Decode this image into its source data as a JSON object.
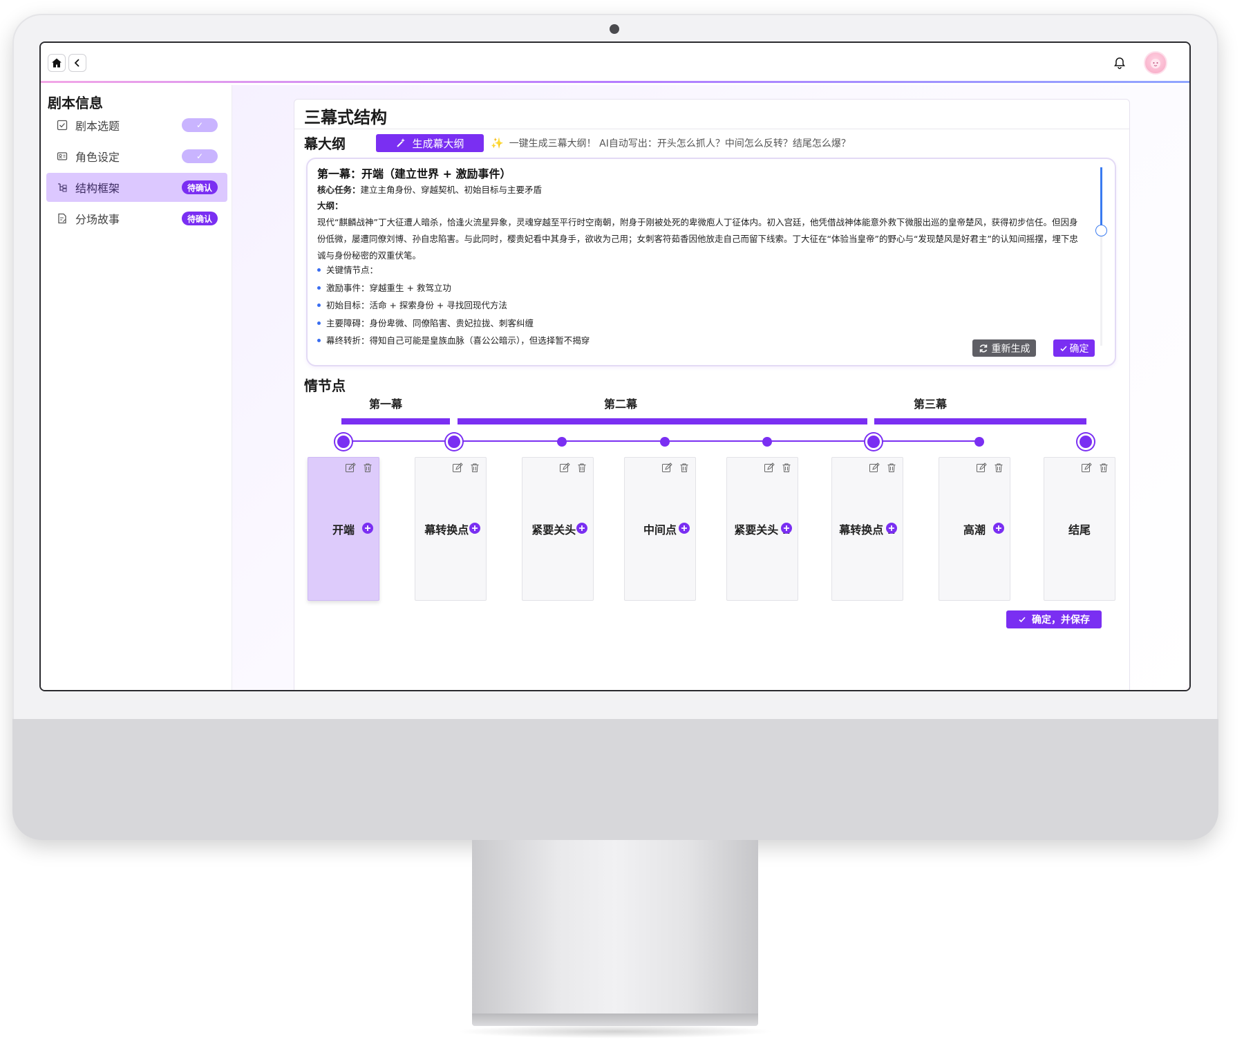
{
  "sidebar": {
    "title": "剧本信息",
    "items": [
      {
        "label": "剧本选题",
        "badge": "✓",
        "state": "done"
      },
      {
        "label": "角色设定",
        "badge": "✓",
        "state": "done"
      },
      {
        "label": "结构框架",
        "badge": "待确认",
        "state": "pending",
        "active": true
      },
      {
        "label": "分场故事",
        "badge": "待确认",
        "state": "pending"
      }
    ]
  },
  "main": {
    "title": "三幕式结构",
    "outline": {
      "section_title": "幕大纲",
      "generate_label": "生成幕大纲",
      "hint": "一键生成三幕大纲！ AI自动写出：开头怎么抓人？中间怎么反转？结尾怎么爆？",
      "heading": "第一幕：开端（建立世界 + 激励事件）",
      "task_label": "核心任务：",
      "task_text": "建立主角身份、穿越契机、初始目标与主要矛盾",
      "summary_label": "大纲：",
      "summary_text": "现代“麒麟战神”丁大征遭人暗杀，恰逢火流星异象，灵魂穿越至平行时空南朝，附身于刚被处死的卑微庖人丁征体内。初入宫廷，他凭借战神体能意外救下微服出巡的皇帝楚风，获得初步信任。但因身份低微，屡遭同僚刘博、孙自忠陷害。与此同时，樱贵妃看中其身手，欲收为己用；女刺客符茹香因他放走自己而留下线索。丁大征在“体验当皇帝”的野心与“发现楚风是好君主”的认知间摇摆，埋下忠诚与身份秘密的双重伏笔。",
      "bullets": [
        "关键情节点：",
        "激励事件：穿越重生 + 救驾立功",
        "初始目标：活命 + 探索身份 + 寻找回现代方法",
        "主要障碍：身份卑微、同僚陷害、贵妃拉拢、刺客纠缠",
        "幕终转折：得知自己可能是皇族血脉（喜公公暗示），但选择暂不揭穿"
      ],
      "regen_label": "重新生成",
      "confirm_label": "确定"
    },
    "plot": {
      "section_title": "情节点",
      "acts": [
        "第一幕",
        "第二幕",
        "第三幕"
      ],
      "points": [
        "开端",
        "幕转换点 I",
        "紧要关头 I",
        "中间点",
        "紧要关头 II",
        "幕转换点 II",
        "高潮",
        "结尾"
      ],
      "save_label": "确定，并保存"
    }
  },
  "colors": {
    "accent": "#7a2ff2",
    "accent_light": "#dcc8ff",
    "scroll": "#3a7bf0"
  }
}
